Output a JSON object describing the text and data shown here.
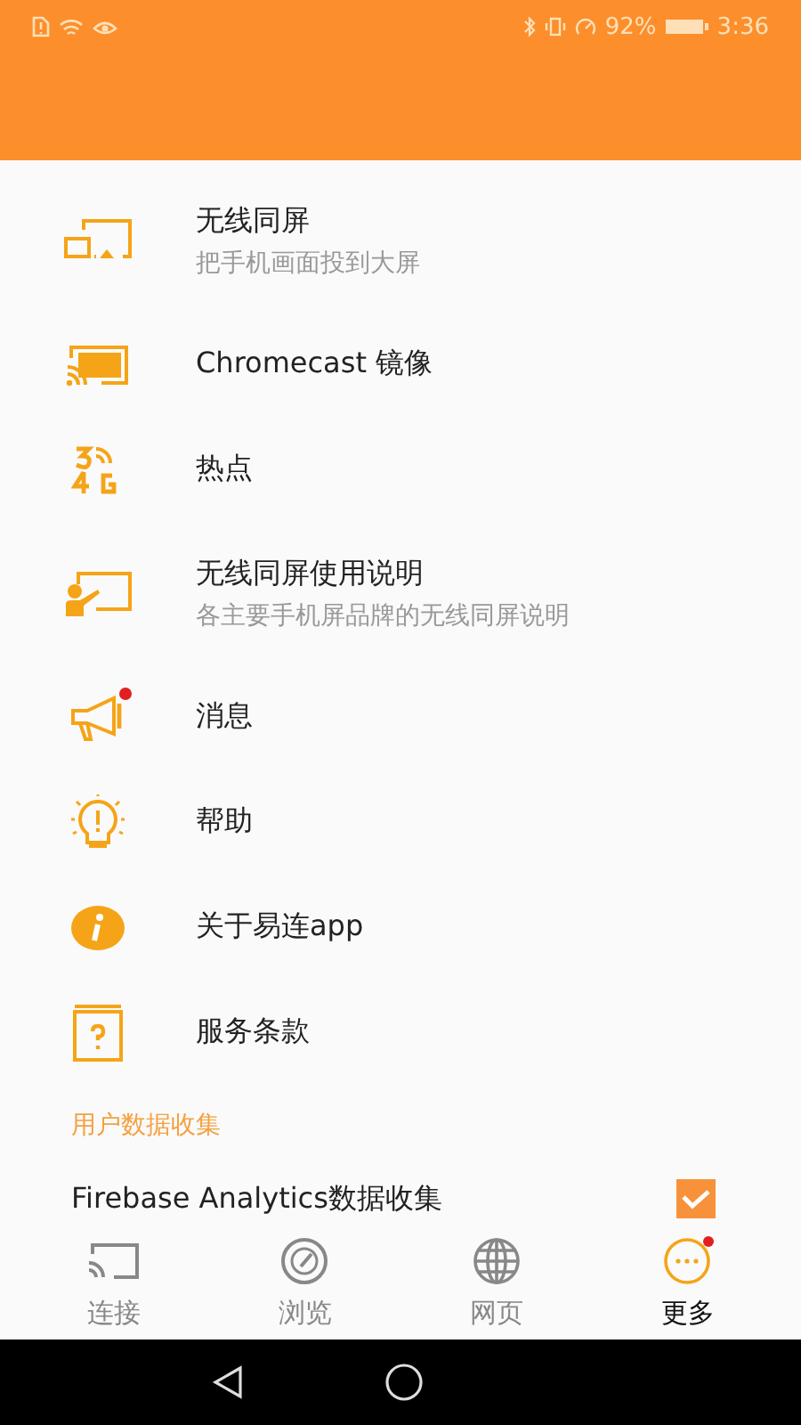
{
  "status_bar": {
    "battery": "92%",
    "time": "3:36"
  },
  "menu": [
    {
      "title": "无线同屏",
      "subtitle": "把手机画面投到大屏",
      "badge": false
    },
    {
      "title": "Chromecast 镜像",
      "badge": false
    },
    {
      "title": "热点",
      "badge": false
    },
    {
      "title": "无线同屏使用说明",
      "subtitle": "各主要手机屏品牌的无线同屏说明",
      "badge": false
    },
    {
      "title": "消息",
      "badge": true
    },
    {
      "title": "帮助",
      "badge": false
    },
    {
      "title": "关于易连app",
      "badge": false
    },
    {
      "title": "服务条款",
      "badge": false
    }
  ],
  "section": {
    "title": "用户数据收集",
    "items": [
      {
        "label": "Firebase Analytics数据收集",
        "checked": true
      }
    ]
  },
  "bottom_nav": [
    {
      "label": "连接",
      "selected": false,
      "badge": false
    },
    {
      "label": "浏览",
      "selected": false,
      "badge": false
    },
    {
      "label": "网页",
      "selected": false,
      "badge": false
    },
    {
      "label": "更多",
      "selected": true,
      "badge": true
    }
  ]
}
